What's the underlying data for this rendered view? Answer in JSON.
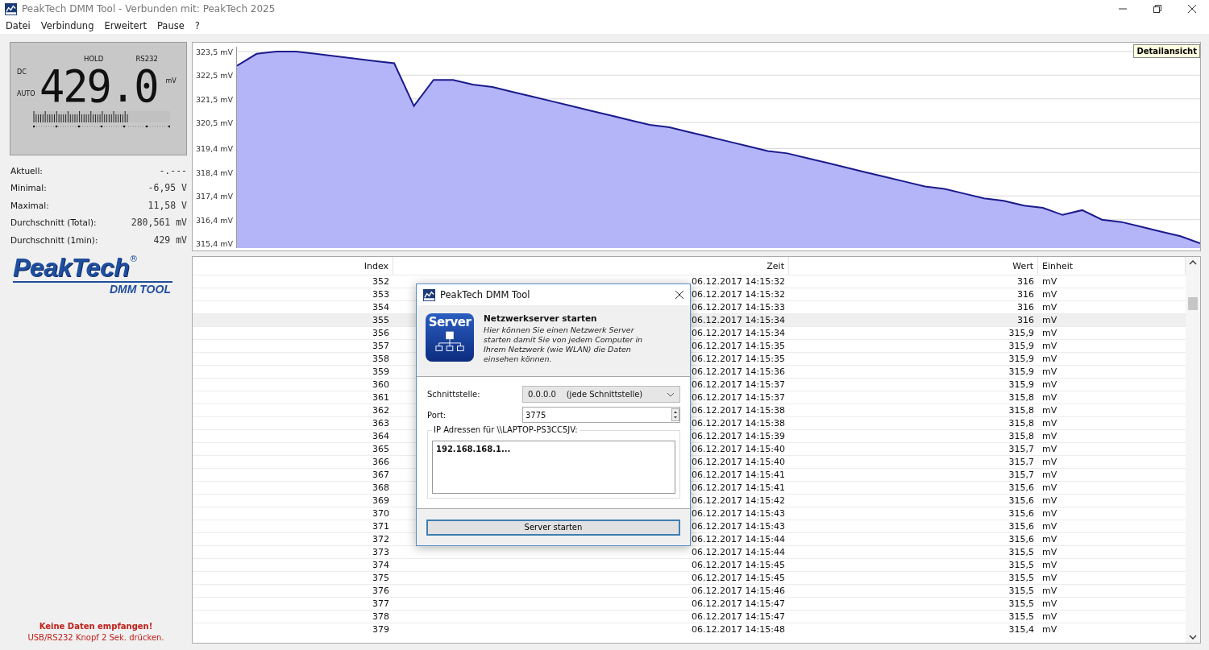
{
  "window": {
    "title": "PeakTech DMM Tool - Verbunden mit: PeakTech 2025"
  },
  "menu": [
    "Datei",
    "Verbindung",
    "Erweitert",
    "Pause",
    "?"
  ],
  "display": {
    "mode": "DC",
    "range": "AUTO",
    "hold": "HOLD",
    "interface": "RS232",
    "reading": "429.0",
    "unit": "mV",
    "bargraph": {
      "level": 0.7
    }
  },
  "stats": [
    {
      "label": "Aktuell:",
      "value": "-.---"
    },
    {
      "label": "Minimal:",
      "value": "-6,95 V"
    },
    {
      "label": "Maximal:",
      "value": "11,58 V"
    },
    {
      "label": "Durchschnitt (Total):",
      "value": "280,561 mV"
    },
    {
      "label": "Durchschnitt (1min):",
      "value": "429 mV"
    }
  ],
  "logo": {
    "brand": "PeakTech",
    "registered": "®",
    "subtitle": "DMM TOOL"
  },
  "status": {
    "title": "Keine Daten empfangen!",
    "hint": "USB/RS232 Knopf 2 Sek. drücken."
  },
  "chart": {
    "badge": "Detailansicht",
    "chart_data": {
      "type": "area",
      "grid": true,
      "ylim": [
        315.2,
        323.7
      ],
      "yticks": [
        {
          "value": 323.5,
          "label": "323,5 mV"
        },
        {
          "value": 322.5,
          "label": "322,5 mV"
        },
        {
          "value": 321.5,
          "label": "321,5 mV"
        },
        {
          "value": 320.5,
          "label": "320,5 mV"
        },
        {
          "value": 319.4,
          "label": "319,4 mV"
        },
        {
          "value": 318.4,
          "label": "318,4 mV"
        },
        {
          "value": 317.4,
          "label": "317,4 mV"
        },
        {
          "value": 316.4,
          "label": "316,4 mV"
        },
        {
          "value": 315.4,
          "label": "315,4 mV"
        }
      ],
      "series": [
        {
          "color": "#1a1a8c",
          "values": [
            322.9,
            323.4,
            323.5,
            323.5,
            323.4,
            323.3,
            323.2,
            323.1,
            323.0,
            321.2,
            322.3,
            322.3,
            322.1,
            322.0,
            321.8,
            321.6,
            321.4,
            321.2,
            321.0,
            320.8,
            320.6,
            320.4,
            320.3,
            320.1,
            319.9,
            319.7,
            319.5,
            319.3,
            319.2,
            319.0,
            318.8,
            318.6,
            318.4,
            318.2,
            318.0,
            317.8,
            317.7,
            317.5,
            317.3,
            317.2,
            317.0,
            316.9,
            316.6,
            316.8,
            316.4,
            316.3,
            316.1,
            315.9,
            315.7,
            315.4
          ]
        }
      ]
    }
  },
  "table": {
    "columns": [
      "Index",
      "Zeit",
      "Wert",
      "Einheit"
    ],
    "rows": [
      {
        "cells": [
          "352",
          "06.12.2017 14:15:32",
          "316",
          "mV"
        ],
        "selected": false
      },
      {
        "cells": [
          "353",
          "06.12.2017 14:15:32",
          "316",
          "mV"
        ],
        "selected": false
      },
      {
        "cells": [
          "354",
          "06.12.2017 14:15:33",
          "316",
          "mV"
        ],
        "selected": false
      },
      {
        "cells": [
          "355",
          "06.12.2017 14:15:34",
          "316",
          "mV"
        ],
        "selected": true
      },
      {
        "cells": [
          "356",
          "06.12.2017 14:15:34",
          "315,9",
          "mV"
        ],
        "selected": false
      },
      {
        "cells": [
          "357",
          "06.12.2017 14:15:35",
          "315,9",
          "mV"
        ],
        "selected": false
      },
      {
        "cells": [
          "358",
          "06.12.2017 14:15:35",
          "315,9",
          "mV"
        ],
        "selected": false
      },
      {
        "cells": [
          "359",
          "06.12.2017 14:15:36",
          "315,9",
          "mV"
        ],
        "selected": false
      },
      {
        "cells": [
          "360",
          "06.12.2017 14:15:37",
          "315,9",
          "mV"
        ],
        "selected": false
      },
      {
        "cells": [
          "361",
          "06.12.2017 14:15:37",
          "315,8",
          "mV"
        ],
        "selected": false
      },
      {
        "cells": [
          "362",
          "06.12.2017 14:15:38",
          "315,8",
          "mV"
        ],
        "selected": false
      },
      {
        "cells": [
          "363",
          "06.12.2017 14:15:38",
          "315,8",
          "mV"
        ],
        "selected": false
      },
      {
        "cells": [
          "364",
          "06.12.2017 14:15:39",
          "315,8",
          "mV"
        ],
        "selected": false
      },
      {
        "cells": [
          "365",
          "06.12.2017 14:15:40",
          "315,7",
          "mV"
        ],
        "selected": false
      },
      {
        "cells": [
          "366",
          "06.12.2017 14:15:40",
          "315,7",
          "mV"
        ],
        "selected": false
      },
      {
        "cells": [
          "367",
          "06.12.2017 14:15:41",
          "315,7",
          "mV"
        ],
        "selected": false
      },
      {
        "cells": [
          "368",
          "06.12.2017 14:15:41",
          "315,6",
          "mV"
        ],
        "selected": false
      },
      {
        "cells": [
          "369",
          "06.12.2017 14:15:42",
          "315,6",
          "mV"
        ],
        "selected": false
      },
      {
        "cells": [
          "370",
          "06.12.2017 14:15:43",
          "315,6",
          "mV"
        ],
        "selected": false
      },
      {
        "cells": [
          "371",
          "06.12.2017 14:15:43",
          "315,6",
          "mV"
        ],
        "selected": false
      },
      {
        "cells": [
          "372",
          "06.12.2017 14:15:44",
          "315,6",
          "mV"
        ],
        "selected": false
      },
      {
        "cells": [
          "373",
          "06.12.2017 14:15:44",
          "315,5",
          "mV"
        ],
        "selected": false
      },
      {
        "cells": [
          "374",
          "06.12.2017 14:15:45",
          "315,5",
          "mV"
        ],
        "selected": false
      },
      {
        "cells": [
          "375",
          "06.12.2017 14:15:45",
          "315,5",
          "mV"
        ],
        "selected": false
      },
      {
        "cells": [
          "376",
          "06.12.2017 14:15:46",
          "315,5",
          "mV"
        ],
        "selected": false
      },
      {
        "cells": [
          "377",
          "06.12.2017 14:15:47",
          "315,5",
          "mV"
        ],
        "selected": false
      },
      {
        "cells": [
          "378",
          "06.12.2017 14:15:47",
          "315,5",
          "mV"
        ],
        "selected": false
      },
      {
        "cells": [
          "379",
          "06.12.2017 14:15:48",
          "315,4",
          "mV"
        ],
        "selected": false
      }
    ]
  },
  "dialog": {
    "title": "PeakTech DMM Tool",
    "icon_label": "Server",
    "heading": "Netzwerkserver starten",
    "description": "Hier können Sie einen Netzwerk Server starten damit Sie von jedem Computer in Ihrem Netzwerk (wie WLAN) die Daten einsehen können.",
    "interface_label": "Schnittstelle:",
    "interface_value": "0.0.0.0    (jede Schnittstelle)",
    "port_label": "Port:",
    "port_value": "3775",
    "group_label": "IP Adressen für \\\\LAPTOP-PS3CC5JV:",
    "addresses": [
      "192.168.168.1..."
    ],
    "button": "Server starten"
  }
}
